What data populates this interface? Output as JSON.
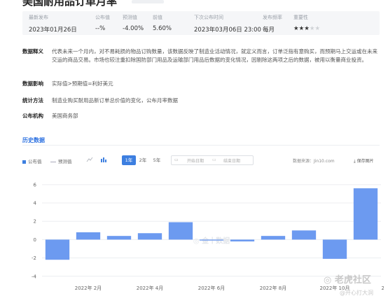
{
  "stats": [
    {
      "label": "最新发布",
      "value": "2023年01月26日"
    },
    {
      "label": "公布值",
      "value": "--%"
    },
    {
      "label": "预测值",
      "value": "-4.00%"
    },
    {
      "label": "前值",
      "value": "5.60%"
    },
    {
      "label": "下次公布时间",
      "value": "2023年03月06日 23:00"
    },
    {
      "label": "发布频率",
      "value": "每月"
    },
    {
      "label": "重要性",
      "stars_on": "★★★",
      "stars_off": "★★"
    }
  ],
  "info": {
    "definition_key": "数据释义",
    "definition_value": "代表未来一个月内，对不易耗损的物品订购数量，该数据反映了制造业活动情况，就定义而言，订单泛指有意购买，而预期马上交运或在未来交运的商品交易。市场也较注重扣除国防部门用品及运输部门用品后数据的变化情况，因剔除这两项之后的数据，被用以衡量商业投资。",
    "impact_key": "数据影响",
    "impact_value": "实际值>预期值=利好美元",
    "method_key": "统计方法",
    "method_value": "制造业购买耐用品新订单总价值的变化，公布月率数据",
    "agency_key": "公布机构",
    "agency_value": "美国商务部"
  },
  "history_title": "历史数据",
  "toolbar": {
    "legend_actual": "公布值",
    "legend_forecast": "预测值",
    "years": [
      "1年",
      "2年",
      "5年"
    ],
    "start_date": "开始日期",
    "end_date": "结束日期",
    "source": "数据来源：Jin10.com",
    "save": "保存图片",
    "line_icon": "line-chart-icon",
    "bar_icon": "bar-chart-icon",
    "calendar_icon": "calendar-icon",
    "download_icon": "download-icon"
  },
  "chart_data": {
    "type": "bar",
    "categories": [
      "2022年1月",
      "2022年2月",
      "2022年3月",
      "2022年4月",
      "2022年5月",
      "2022年6月",
      "2022年7月",
      "2022年8月",
      "2022年9月",
      "2022年10月",
      "2022年11月",
      "2022年12月"
    ],
    "x_tick_labels": [
      "2022年 2月",
      "2022年 4月",
      "2022年 6月",
      "2022年 8月",
      "2022年 10月",
      "2022年 12月"
    ],
    "series": [
      {
        "name": "公布值",
        "values": [
          -2.2,
          0.8,
          0.4,
          0.7,
          1.9,
          -0.1,
          -0.2,
          0.4,
          1.0,
          -2.1,
          5.6
        ]
      }
    ],
    "yticks": [
      6,
      4,
      2,
      0,
      -2,
      -4
    ],
    "ylim": [
      -4.4,
      6.6
    ],
    "bar_color": "#6c9af0",
    "grid": true
  },
  "watermark": {
    "chart_center": "金十数据",
    "tiger": "老虎社区",
    "user": "@开心打大洞"
  }
}
